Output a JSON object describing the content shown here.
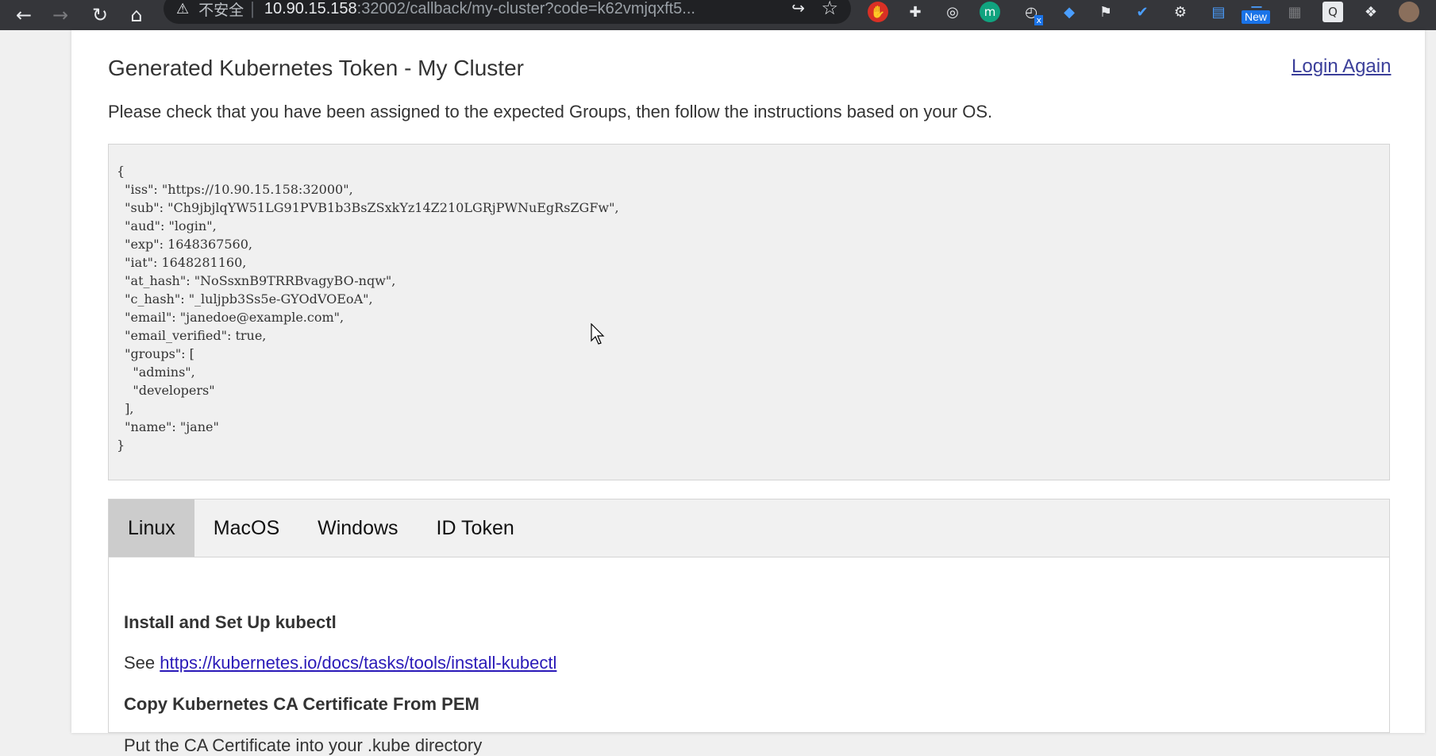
{
  "browser": {
    "security_label": "不安全",
    "url_host": "10.90.15.158",
    "url_rest": ":32002/callback/my-cluster?code=k62vmjqxft5...",
    "new_badge": "New",
    "ext_letters": [
      "m",
      "x",
      "Q"
    ],
    "icons": [
      "back-arrow-icon",
      "forward-arrow-icon",
      "reload-icon",
      "home-icon",
      "warning-icon",
      "share-icon",
      "star-icon",
      "puzzle-icon"
    ]
  },
  "page": {
    "title": "Generated Kubernetes Token - My Cluster",
    "login_again": "Login Again",
    "instructions": "Please check that you have been assigned to the expected Groups, then follow the instructions based on your OS.",
    "token_json": "{\n  \"iss\": \"https://10.90.15.158:32000\",\n  \"sub\": \"Ch9jbjlqYW51LG91PVB1b3BsZSxkYz14Z210LGRjPWNuEgRsZGFw\",\n  \"aud\": \"login\",\n  \"exp\": 1648367560,\n  \"iat\": 1648281160,\n  \"at_hash\": \"NoSsxnB9TRRBvagyBO-nqw\",\n  \"c_hash\": \"_luljpb3Ss5e-GYOdVOEoA\",\n  \"email\": \"janedoe@example.com\",\n  \"email_verified\": true,\n  \"groups\": [\n    \"admins\",\n    \"developers\"\n  ],\n  \"name\": \"jane\"\n}",
    "tabs": [
      "Linux",
      "MacOS",
      "Windows",
      "ID Token"
    ],
    "active_tab": "Linux",
    "section1_heading": "Install and Set Up kubectl",
    "section1_prefix": "See ",
    "section1_link": "https://kubernetes.io/docs/tasks/tools/install-kubectl",
    "section2_heading": "Copy Kubernetes CA Certificate From PEM",
    "section2_text": "Put the CA Certificate into your .kube directory"
  },
  "colors": {
    "chrome_bg": "#35363a",
    "omnibox_bg": "#202124",
    "active_tab_bg": "#cccccc",
    "link": "#2a1ab8",
    "json_bg": "#f0f0f0"
  }
}
